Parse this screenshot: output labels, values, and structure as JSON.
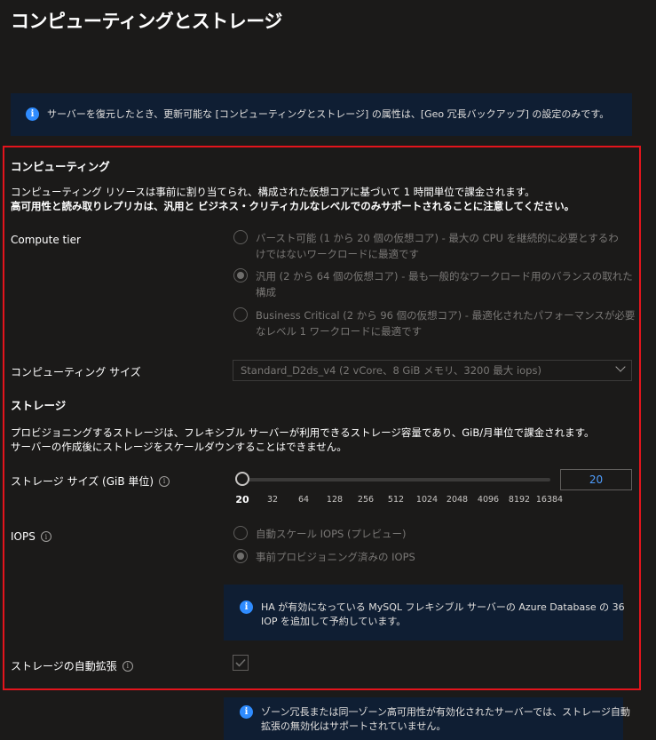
{
  "header": {
    "title": "コンピューティングとストレージ",
    "more": "···"
  },
  "top_info": {
    "icon": "info-icon",
    "text": "サーバーを復元したとき、更新可能な [コンピューティングとストレージ] の属性は、[Geo 冗長バックアップ] の設定のみです。"
  },
  "compute": {
    "heading": "コンピューティング",
    "desc_line1": "コンピューティング リソースは事前に割り当てられ、構成された仮想コアに基づいて 1 時間単位で課金されます。",
    "desc_line2": "高可用性と読み取りレプリカは、汎用と ビジネス・クリティカルなレベルでのみサポートされることに注意してください。",
    "tier_label": "Compute tier",
    "tiers": [
      {
        "line1": "バースト可能 (1 から 20 個の仮想コア) - 最大の CPU を継続的に必要とするわ",
        "line2": "けではないワークロードに最適です",
        "selected": false
      },
      {
        "line1": "汎用 (2 から 64 個の仮想コア) - 最も一般的なワークロード用のバランスの取れた",
        "line2": "構成",
        "selected": true
      },
      {
        "line1": "Business Critical (2 から 96 個の仮想コア) - 最適化されたパフォーマンスが必要",
        "line2": "なレベル 1 ワークロードに最適です",
        "selected": false
      }
    ],
    "size_label": "コンピューティング サイズ",
    "size_value": "Standard_D2ds_v4 (2 vCore、8 GiB メモリ、3200 最大 iops)"
  },
  "storage": {
    "heading": "ストレージ",
    "desc_line1": "プロビジョニングするストレージは、フレキシブル サーバーが利用できるストレージ容量であり、GiB/月単位で課金されます。",
    "desc_line2": "サーバーの作成後にストレージをスケールダウンすることはできません。",
    "size_label": "ストレージ サイズ (GiB 単位)",
    "ticks": [
      "20",
      "32",
      "64",
      "128",
      "256",
      "512",
      "1024",
      "2048",
      "4096",
      "8192",
      "16384"
    ],
    "size_value": "20",
    "iops_label": "IOPS",
    "iops_options": [
      {
        "label": "自動スケール IOPS (プレビュー)",
        "selected": false
      },
      {
        "label": "事前プロビジョニング済みの IOPS",
        "selected": true
      }
    ],
    "ha_info_line1": "HA が有効になっている MySQL フレキシブル サーバーの Azure Database の 36",
    "ha_info_line2": "IOP を追加して予約しています。",
    "autogrow_label": "ストレージの自動拡張",
    "autogrow_checked": true,
    "zone_info_line1": "ゾーン冗長または同一ゾーン高可用性が有効化されたサーバーでは、ストレージ自動",
    "zone_info_line2": "拡張の無効化はサポートされていません。"
  },
  "colors": {
    "background": "#1b1a19",
    "info_background": "#0f1e33",
    "info_icon": "#2f8cff",
    "highlight_frame": "#e3141c",
    "input_value": "#4f9eff"
  }
}
